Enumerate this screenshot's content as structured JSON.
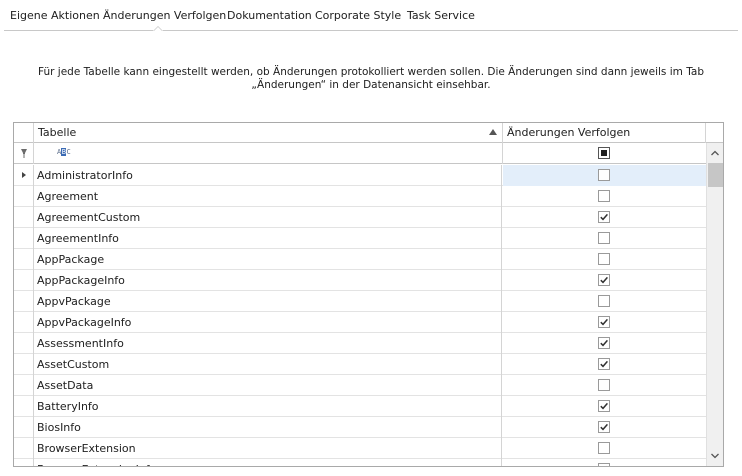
{
  "tabs": [
    {
      "label": "Eigene Aktionen"
    },
    {
      "label": "Änderungen Verfolgen"
    },
    {
      "label": "Dokumentation"
    },
    {
      "label": "Corporate Style"
    },
    {
      "label": "Task Service"
    }
  ],
  "description": "Für jede Tabelle kann eingestellt werden, ob Änderungen protokolliert werden sollen. Die Änderungen sind dann jeweils im Tab „Änderungen“ in der Datenansicht einsehbar.",
  "grid": {
    "columns": {
      "table": "Tabelle",
      "track": "Änderungen Verfolgen"
    },
    "filter_icon": "funnel-pin-icon",
    "filter_operator": "ABC",
    "rows": [
      {
        "name": "AdministratorInfo",
        "checked": false
      },
      {
        "name": "Agreement",
        "checked": false
      },
      {
        "name": "AgreementCustom",
        "checked": true
      },
      {
        "name": "AgreementInfo",
        "checked": false
      },
      {
        "name": "AppPackage",
        "checked": false
      },
      {
        "name": "AppPackageInfo",
        "checked": true
      },
      {
        "name": "AppvPackage",
        "checked": false
      },
      {
        "name": "AppvPackageInfo",
        "checked": true
      },
      {
        "name": "AssessmentInfo",
        "checked": true
      },
      {
        "name": "AssetCustom",
        "checked": true
      },
      {
        "name": "AssetData",
        "checked": false
      },
      {
        "name": "BatteryInfo",
        "checked": true
      },
      {
        "name": "BiosInfo",
        "checked": true
      },
      {
        "name": "BrowserExtension",
        "checked": false
      },
      {
        "name": "BrowserExtensionInfo",
        "checked": true
      }
    ]
  }
}
